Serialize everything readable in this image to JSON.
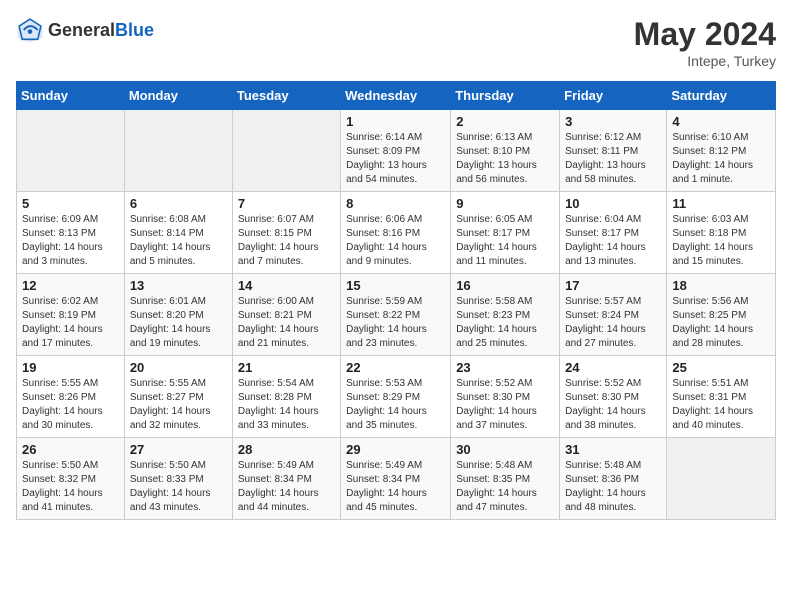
{
  "header": {
    "logo_general": "General",
    "logo_blue": "Blue",
    "month_year": "May 2024",
    "location": "Intepe, Turkey"
  },
  "days_of_week": [
    "Sunday",
    "Monday",
    "Tuesday",
    "Wednesday",
    "Thursday",
    "Friday",
    "Saturday"
  ],
  "weeks": [
    [
      {
        "day": "",
        "sunrise": "",
        "sunset": "",
        "daylight": "",
        "empty": true
      },
      {
        "day": "",
        "sunrise": "",
        "sunset": "",
        "daylight": "",
        "empty": true
      },
      {
        "day": "",
        "sunrise": "",
        "sunset": "",
        "daylight": "",
        "empty": true
      },
      {
        "day": "1",
        "sunrise": "Sunrise: 6:14 AM",
        "sunset": "Sunset: 8:09 PM",
        "daylight": "Daylight: 13 hours and 54 minutes.",
        "empty": false
      },
      {
        "day": "2",
        "sunrise": "Sunrise: 6:13 AM",
        "sunset": "Sunset: 8:10 PM",
        "daylight": "Daylight: 13 hours and 56 minutes.",
        "empty": false
      },
      {
        "day": "3",
        "sunrise": "Sunrise: 6:12 AM",
        "sunset": "Sunset: 8:11 PM",
        "daylight": "Daylight: 13 hours and 58 minutes.",
        "empty": false
      },
      {
        "day": "4",
        "sunrise": "Sunrise: 6:10 AM",
        "sunset": "Sunset: 8:12 PM",
        "daylight": "Daylight: 14 hours and 1 minute.",
        "empty": false
      }
    ],
    [
      {
        "day": "5",
        "sunrise": "Sunrise: 6:09 AM",
        "sunset": "Sunset: 8:13 PM",
        "daylight": "Daylight: 14 hours and 3 minutes.",
        "empty": false
      },
      {
        "day": "6",
        "sunrise": "Sunrise: 6:08 AM",
        "sunset": "Sunset: 8:14 PM",
        "daylight": "Daylight: 14 hours and 5 minutes.",
        "empty": false
      },
      {
        "day": "7",
        "sunrise": "Sunrise: 6:07 AM",
        "sunset": "Sunset: 8:15 PM",
        "daylight": "Daylight: 14 hours and 7 minutes.",
        "empty": false
      },
      {
        "day": "8",
        "sunrise": "Sunrise: 6:06 AM",
        "sunset": "Sunset: 8:16 PM",
        "daylight": "Daylight: 14 hours and 9 minutes.",
        "empty": false
      },
      {
        "day": "9",
        "sunrise": "Sunrise: 6:05 AM",
        "sunset": "Sunset: 8:17 PM",
        "daylight": "Daylight: 14 hours and 11 minutes.",
        "empty": false
      },
      {
        "day": "10",
        "sunrise": "Sunrise: 6:04 AM",
        "sunset": "Sunset: 8:17 PM",
        "daylight": "Daylight: 14 hours and 13 minutes.",
        "empty": false
      },
      {
        "day": "11",
        "sunrise": "Sunrise: 6:03 AM",
        "sunset": "Sunset: 8:18 PM",
        "daylight": "Daylight: 14 hours and 15 minutes.",
        "empty": false
      }
    ],
    [
      {
        "day": "12",
        "sunrise": "Sunrise: 6:02 AM",
        "sunset": "Sunset: 8:19 PM",
        "daylight": "Daylight: 14 hours and 17 minutes.",
        "empty": false
      },
      {
        "day": "13",
        "sunrise": "Sunrise: 6:01 AM",
        "sunset": "Sunset: 8:20 PM",
        "daylight": "Daylight: 14 hours and 19 minutes.",
        "empty": false
      },
      {
        "day": "14",
        "sunrise": "Sunrise: 6:00 AM",
        "sunset": "Sunset: 8:21 PM",
        "daylight": "Daylight: 14 hours and 21 minutes.",
        "empty": false
      },
      {
        "day": "15",
        "sunrise": "Sunrise: 5:59 AM",
        "sunset": "Sunset: 8:22 PM",
        "daylight": "Daylight: 14 hours and 23 minutes.",
        "empty": false
      },
      {
        "day": "16",
        "sunrise": "Sunrise: 5:58 AM",
        "sunset": "Sunset: 8:23 PM",
        "daylight": "Daylight: 14 hours and 25 minutes.",
        "empty": false
      },
      {
        "day": "17",
        "sunrise": "Sunrise: 5:57 AM",
        "sunset": "Sunset: 8:24 PM",
        "daylight": "Daylight: 14 hours and 27 minutes.",
        "empty": false
      },
      {
        "day": "18",
        "sunrise": "Sunrise: 5:56 AM",
        "sunset": "Sunset: 8:25 PM",
        "daylight": "Daylight: 14 hours and 28 minutes.",
        "empty": false
      }
    ],
    [
      {
        "day": "19",
        "sunrise": "Sunrise: 5:55 AM",
        "sunset": "Sunset: 8:26 PM",
        "daylight": "Daylight: 14 hours and 30 minutes.",
        "empty": false
      },
      {
        "day": "20",
        "sunrise": "Sunrise: 5:55 AM",
        "sunset": "Sunset: 8:27 PM",
        "daylight": "Daylight: 14 hours and 32 minutes.",
        "empty": false
      },
      {
        "day": "21",
        "sunrise": "Sunrise: 5:54 AM",
        "sunset": "Sunset: 8:28 PM",
        "daylight": "Daylight: 14 hours and 33 minutes.",
        "empty": false
      },
      {
        "day": "22",
        "sunrise": "Sunrise: 5:53 AM",
        "sunset": "Sunset: 8:29 PM",
        "daylight": "Daylight: 14 hours and 35 minutes.",
        "empty": false
      },
      {
        "day": "23",
        "sunrise": "Sunrise: 5:52 AM",
        "sunset": "Sunset: 8:30 PM",
        "daylight": "Daylight: 14 hours and 37 minutes.",
        "empty": false
      },
      {
        "day": "24",
        "sunrise": "Sunrise: 5:52 AM",
        "sunset": "Sunset: 8:30 PM",
        "daylight": "Daylight: 14 hours and 38 minutes.",
        "empty": false
      },
      {
        "day": "25",
        "sunrise": "Sunrise: 5:51 AM",
        "sunset": "Sunset: 8:31 PM",
        "daylight": "Daylight: 14 hours and 40 minutes.",
        "empty": false
      }
    ],
    [
      {
        "day": "26",
        "sunrise": "Sunrise: 5:50 AM",
        "sunset": "Sunset: 8:32 PM",
        "daylight": "Daylight: 14 hours and 41 minutes.",
        "empty": false
      },
      {
        "day": "27",
        "sunrise": "Sunrise: 5:50 AM",
        "sunset": "Sunset: 8:33 PM",
        "daylight": "Daylight: 14 hours and 43 minutes.",
        "empty": false
      },
      {
        "day": "28",
        "sunrise": "Sunrise: 5:49 AM",
        "sunset": "Sunset: 8:34 PM",
        "daylight": "Daylight: 14 hours and 44 minutes.",
        "empty": false
      },
      {
        "day": "29",
        "sunrise": "Sunrise: 5:49 AM",
        "sunset": "Sunset: 8:34 PM",
        "daylight": "Daylight: 14 hours and 45 minutes.",
        "empty": false
      },
      {
        "day": "30",
        "sunrise": "Sunrise: 5:48 AM",
        "sunset": "Sunset: 8:35 PM",
        "daylight": "Daylight: 14 hours and 47 minutes.",
        "empty": false
      },
      {
        "day": "31",
        "sunrise": "Sunrise: 5:48 AM",
        "sunset": "Sunset: 8:36 PM",
        "daylight": "Daylight: 14 hours and 48 minutes.",
        "empty": false
      },
      {
        "day": "",
        "sunrise": "",
        "sunset": "",
        "daylight": "",
        "empty": true
      }
    ]
  ]
}
